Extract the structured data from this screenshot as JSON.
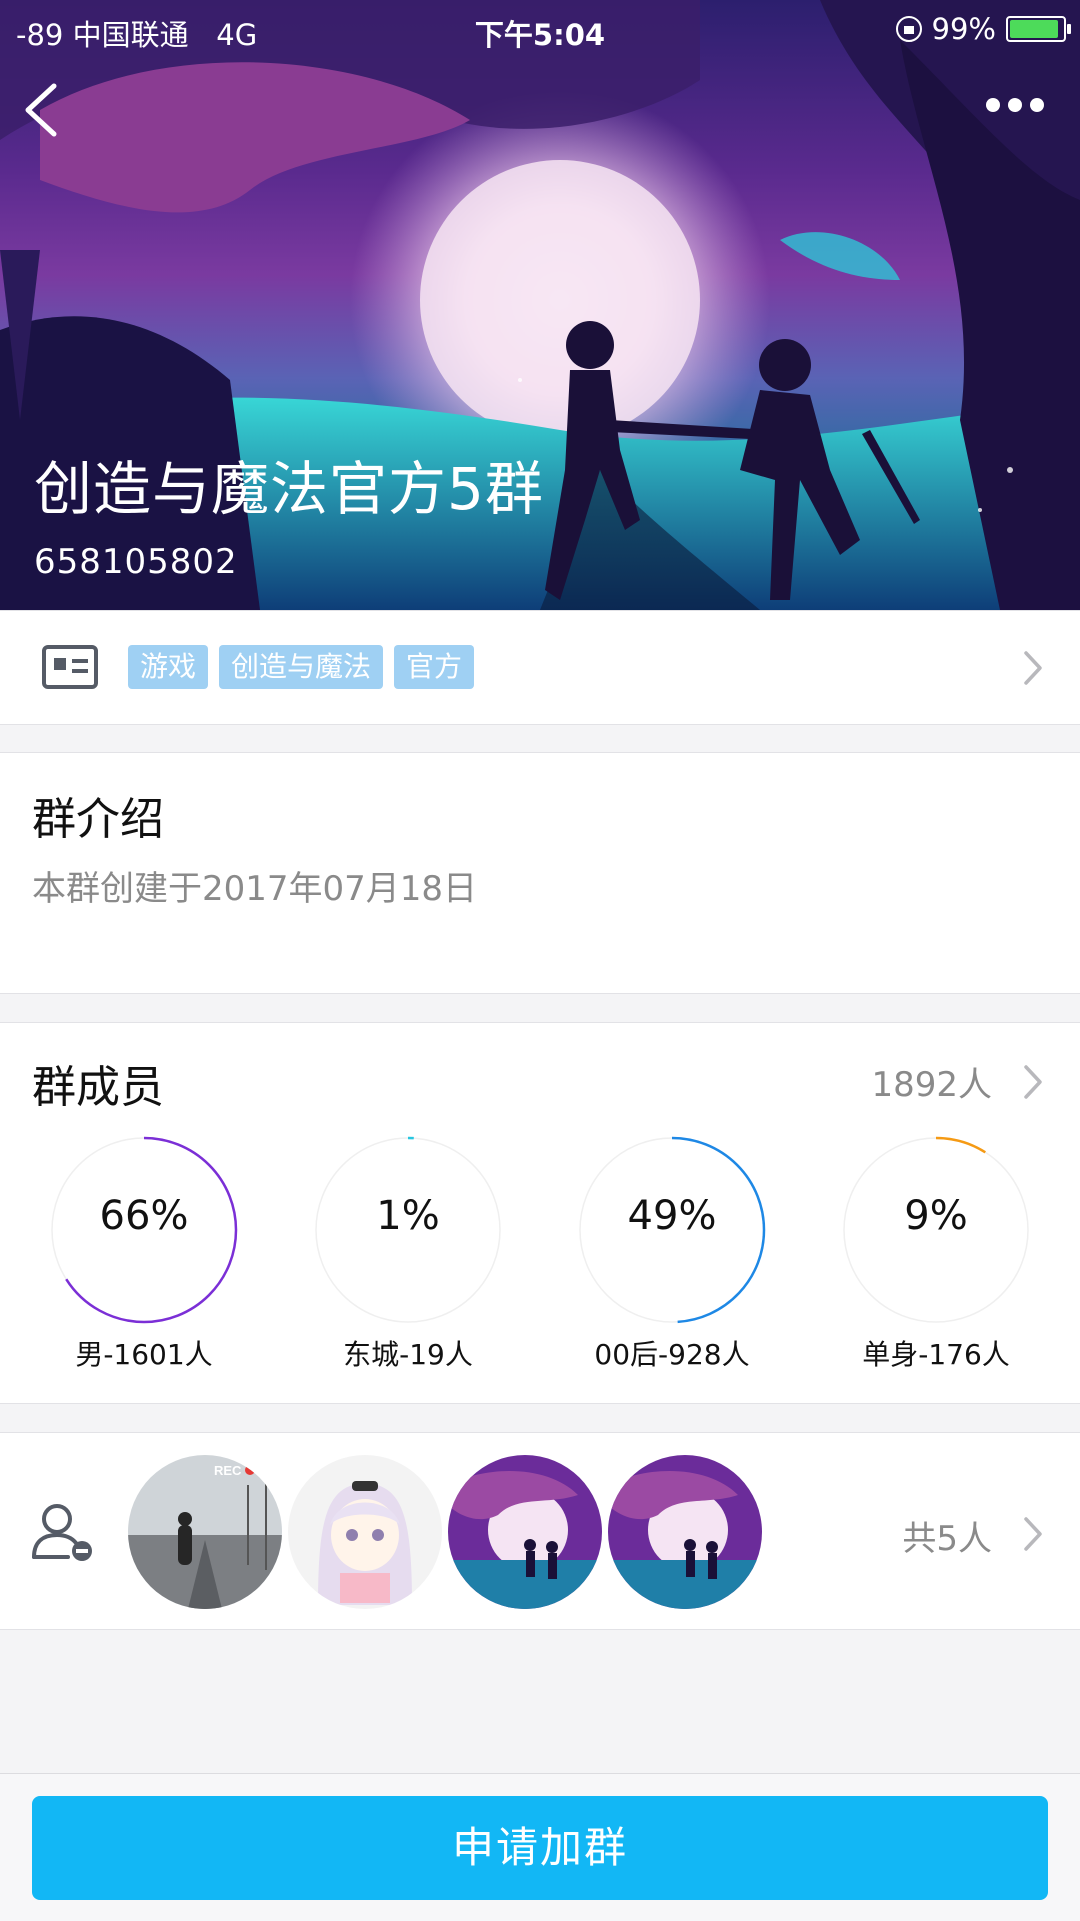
{
  "status_bar": {
    "carrier": "-89 中国联通",
    "network": "4G",
    "time": "下午5:04",
    "battery": "99%"
  },
  "header": {
    "group_name": "创造与魔法官方5群",
    "group_id": "658105802"
  },
  "tags": [
    "游戏",
    "创造与魔法",
    "官方"
  ],
  "intro": {
    "title": "群介绍",
    "text": "本群创建于2017年07月18日"
  },
  "members": {
    "title": "群成员",
    "count": "1892人",
    "stats": [
      {
        "percent": "66%",
        "value": 0.66,
        "label": "男-1601人",
        "color": "#7b2fd6"
      },
      {
        "percent": "1%",
        "value": 0.01,
        "label": "东城-19人",
        "color": "#27c6e0"
      },
      {
        "percent": "49%",
        "value": 0.49,
        "label": "00后-928人",
        "color": "#1e88e5"
      },
      {
        "percent": "9%",
        "value": 0.09,
        "label": "单身-176人",
        "color": "#f59a14"
      }
    ]
  },
  "avatar_row": {
    "total": "共5人"
  },
  "join_button": "申请加群"
}
